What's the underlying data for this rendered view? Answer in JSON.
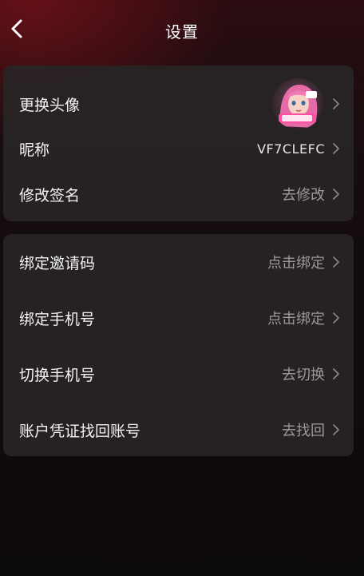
{
  "header": {
    "title": "设置"
  },
  "profile_section": {
    "avatar_label": "更换头像",
    "nickname_label": "昵称",
    "nickname_value": "VF7CLEFC",
    "signature_label": "修改签名",
    "signature_action": "去修改"
  },
  "account_section": {
    "items": [
      {
        "label": "绑定邀请码",
        "action": "点击绑定"
      },
      {
        "label": "绑定手机号",
        "action": "点击绑定"
      },
      {
        "label": "切换手机号",
        "action": "去切换"
      },
      {
        "label": "账户凭证找回账号",
        "action": "去找回"
      }
    ]
  },
  "colors": {
    "card_bg": "#282425",
    "accent_red": "#96141e",
    "muted_text": "#9a9a9a"
  },
  "icons": [
    "back-arrow-icon",
    "chevron-right-icon",
    "avatar-image"
  ]
}
